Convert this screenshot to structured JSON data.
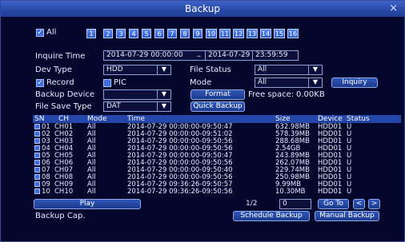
{
  "window": {
    "title": "Backup",
    "close_label": "×"
  },
  "channels": {
    "all_label": "All",
    "all_checked": true,
    "items": [
      "1",
      "2",
      "3",
      "4",
      "5",
      "6",
      "7",
      "8",
      "9",
      "10",
      "11",
      "12",
      "13",
      "14",
      "15",
      "16"
    ]
  },
  "inquire": {
    "label": "Inquire Time",
    "start_date": "2014-07-29",
    "start_time": "00:00:00",
    "separator": "–",
    "end_date": "2014-07-29",
    "end_time": "23:59:59"
  },
  "dev_type": {
    "label": "Dev Type",
    "value": "HDD"
  },
  "file_status": {
    "label": "File Status",
    "value": "All"
  },
  "record_cb": {
    "label": "Record",
    "checked": true
  },
  "pic_cb": {
    "label": "PIC",
    "checked": false
  },
  "mode": {
    "label": "Mode",
    "value": "All"
  },
  "inquiry_button": "Inquiry",
  "backup_device": {
    "label": "Backup Device",
    "value": ""
  },
  "format_button": "Format",
  "free_space": {
    "label": "Free space:",
    "value": "0.00KB"
  },
  "file_save_type": {
    "label": "File Save Type",
    "value": "DAT"
  },
  "quick_backup_button": "Quick Backup",
  "table": {
    "headers": [
      "SN",
      "CH",
      "Mode",
      "Time",
      "Size",
      "Device",
      "Status"
    ],
    "rows": [
      {
        "sn": "01",
        "ch": "CH01",
        "mode": "All",
        "time": "2014-07-29 00:00:00-09:50:47",
        "size": "632.98MB",
        "device": "HDD01",
        "status": "U"
      },
      {
        "sn": "02",
        "ch": "CH02",
        "mode": "All",
        "time": "2014-07-29 00:00:00-09:51:02",
        "size": "578.39MB",
        "device": "HDD01",
        "status": "U"
      },
      {
        "sn": "03",
        "ch": "CH03",
        "mode": "All",
        "time": "2014-07-29 00:00:00-09:50:56",
        "size": "288.68MB",
        "device": "HDD01",
        "status": "U"
      },
      {
        "sn": "04",
        "ch": "CH04",
        "mode": "All",
        "time": "2014-07-29 00:00:00-09:50:56",
        "size": "2.54GB",
        "device": "HDD01",
        "status": "U"
      },
      {
        "sn": "05",
        "ch": "CH05",
        "mode": "All",
        "time": "2014-07-29 00:00:00-09:50:47",
        "size": "243.89MB",
        "device": "HDD01",
        "status": "U"
      },
      {
        "sn": "06",
        "ch": "CH06",
        "mode": "All",
        "time": "2014-07-29 00:00:00-09:50:56",
        "size": "262.07MB",
        "device": "HDD01",
        "status": "U"
      },
      {
        "sn": "07",
        "ch": "CH07",
        "mode": "All",
        "time": "2014-07-29 00:00:00-09:50:40",
        "size": "229.74MB",
        "device": "HDD01",
        "status": "U"
      },
      {
        "sn": "08",
        "ch": "CH08",
        "mode": "All",
        "time": "2014-07-29 00:00:00-09:50:56",
        "size": "250.98MB",
        "device": "HDD01",
        "status": "U"
      },
      {
        "sn": "09",
        "ch": "CH09",
        "mode": "All",
        "time": "2014-07-29 09:36:26-09:50:57",
        "size": "9.99MB",
        "device": "HDD01",
        "status": "U"
      },
      {
        "sn": "10",
        "ch": "CH10",
        "mode": "All",
        "time": "2014-07-29 09:36:26-09:50:56",
        "size": "10.30MB",
        "device": "HDD01",
        "status": "U"
      }
    ]
  },
  "footer": {
    "play_button": "Play",
    "page_indicator": "1/2",
    "page_input": "0",
    "goto_button": "Go To",
    "prev_label": "<",
    "next_label": ">",
    "backup_cap_label": "Backup Cap.",
    "schedule_backup_button": "Schedule Backup",
    "manual_backup_button": "Manual Backup"
  }
}
